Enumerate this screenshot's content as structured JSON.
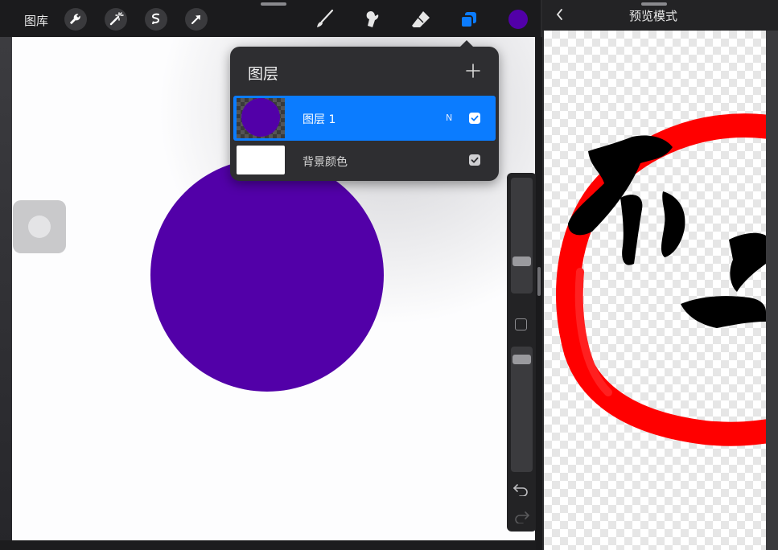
{
  "toolbar": {
    "gallery_label": "图库",
    "tools_left": [
      "wrench-icon",
      "magic-wand-icon",
      "selection-icon",
      "transform-arrow-icon"
    ],
    "tools_right": [
      "brush-icon",
      "smudge-icon",
      "eraser-icon",
      "layers-icon"
    ],
    "current_color": "#5200a8"
  },
  "canvas": {
    "background": "#fdfdfe",
    "circle_color": "#5200a8"
  },
  "layers_panel": {
    "title": "图层",
    "add_label": "+",
    "layers": [
      {
        "name": "图层 1",
        "blend_mode": "N",
        "visible": true,
        "selected": true
      },
      {
        "name": "背景颜色",
        "visible": true,
        "selected": false
      }
    ]
  },
  "preview": {
    "title": "预览模式",
    "back_icon": "chevron-left-icon"
  },
  "colors": {
    "accent": "#0b7cff",
    "toolbar_bg": "#1b1b1d",
    "panel_bg": "#2e2e31",
    "preview_ink": "#000000",
    "preview_red": "#ff0000"
  }
}
